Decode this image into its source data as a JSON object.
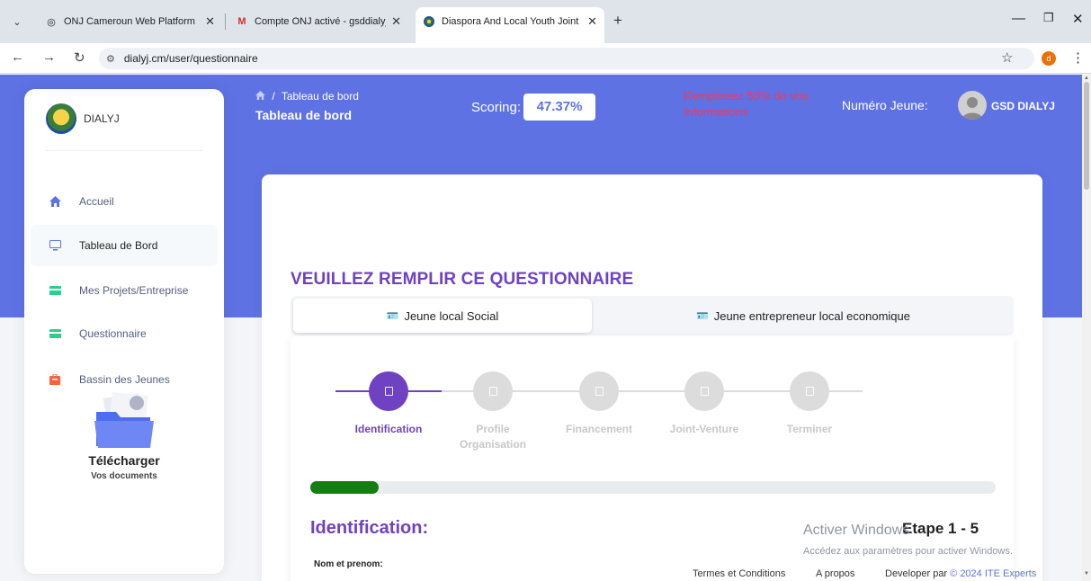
{
  "browser": {
    "tabs": [
      {
        "label": "ONJ Cameroun Web Platform",
        "icon": "globe-icon"
      },
      {
        "label": "Compte ONJ activé - gsddialyj@",
        "icon": "gmail-icon"
      },
      {
        "label": "Diaspora And Local Youth Joint",
        "icon": "site-logo-icon"
      }
    ],
    "new_tab": "+",
    "url": "dialyj.cm/user/questionnaire",
    "profile_initial": "d"
  },
  "sidebar": {
    "brand": "DIALYJ",
    "items": [
      {
        "label": "Accueil",
        "icon": "home-icon",
        "color": "#5e72e4"
      },
      {
        "label": "Tableau de Bord",
        "icon": "monitor-icon",
        "color": "#5e72e4"
      },
      {
        "label": "Mes Projets/Entreprise",
        "icon": "card-icon",
        "color": "#2dce89"
      },
      {
        "label": "Questionnaire",
        "icon": "card-icon",
        "color": "#2dce89"
      },
      {
        "label": "Bassin des Jeunes",
        "icon": "briefcase-icon",
        "color": "#fb6340"
      }
    ],
    "download_title": "Télécharger",
    "download_subtitle": "Vos documents"
  },
  "header": {
    "breadcrumb_sep": "/",
    "breadcrumb": "Tableau de bord",
    "title": "Tableau de bord",
    "scoring_label": "Scoring:",
    "scoring_value": "47.37%",
    "warning": "Remplissez 50% de vos Informations",
    "numero_label": "Numéro Jeune:",
    "user_name": "GSD DIALYJ"
  },
  "main": {
    "title": "VEUILLEZ REMPLIR CE QUESTIONNAIRE",
    "type_tabs": [
      "Jeune local Social",
      "Jeune entrepreneur local economique"
    ],
    "steps": [
      {
        "label": "Identification",
        "state": "active"
      },
      {
        "label": "Profile Organisation",
        "state": "inactive"
      },
      {
        "label": "Financement",
        "state": "inactive"
      },
      {
        "label": "Joint-Venture",
        "state": "inactive"
      },
      {
        "label": "Terminer",
        "state": "inactive"
      }
    ],
    "progress_fraction": 0.1,
    "section_title": "Identification:",
    "step_counter": "Etape 1 - 5",
    "field_label": "Nom et prenom:"
  },
  "watermark": {
    "line1": "Activer Windows",
    "line2": "Accédez aux paramètres pour activer Windows."
  },
  "footer": {
    "terms": "Termes et Conditions",
    "about": "A propos",
    "developer": "Developer par",
    "brand": "© 2024 ITE Experts"
  },
  "colors": {
    "primary": "#5e72e4",
    "purple": "#6f42c1",
    "warning": "#f5365c",
    "progress": "#157d12"
  }
}
